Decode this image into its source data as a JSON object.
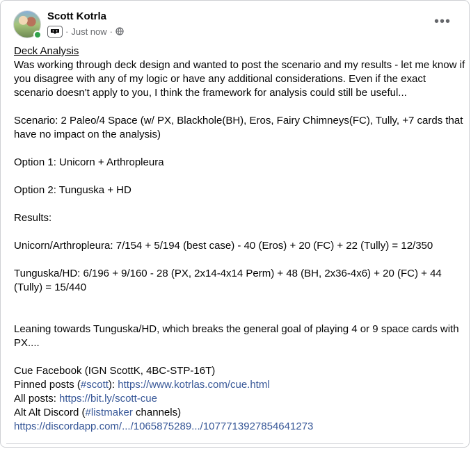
{
  "post": {
    "author": "Scott Kotrla",
    "timestamp": "Just now",
    "separator": "·",
    "title": "Deck Analysis",
    "intro": "Was working through deck design and wanted to post the scenario and my results - let me know if you disagree with any of my logic or have any additional considerations. Even if the exact scenario doesn't apply to you, I think the framework for analysis could still be useful...",
    "scenario": "Scenario: 2 Paleo/4 Space (w/ PX, Blackhole(BH), Eros, Fairy Chimneys(FC), Tully, +7 cards that have no impact on the analysis)",
    "option1": "Option 1: Unicorn + Arthropleura",
    "option2": "Option 2: Tunguska + HD",
    "results_label": "Results:",
    "result1": "Unicorn/Arthropleura: 7/154 + 5/194 (best case) - 40 (Eros) + 20 (FC) + 22 (Tully) = 12/350",
    "result2": "Tunguska/HD: 6/196 + 9/160 - 28 (PX, 2x14-4x14 Perm) + 48 (BH, 2x36-4x6) + 20 (FC) + 44 (Tully) = 15/440",
    "leaning": "Leaning towards Tunguska/HD, which breaks the general goal of playing 4 or 9 space cards with PX....",
    "cue_facebook": "Cue Facebook (IGN ScottK, 4BC-STP-16T)",
    "pinned_prefix": "Pinned posts (",
    "pinned_hashtag": "#scott",
    "pinned_mid": "): ",
    "pinned_link": "https://www.kotrlas.com/cue.html",
    "allposts_prefix": "All posts: ",
    "allposts_link": "https://bit.ly/scott-cue",
    "discord_prefix": "Alt Alt Discord (",
    "discord_hashtag": "#listmaker",
    "discord_suffix": " channels)",
    "discord_link": "https://discordapp.com/.../1065875289.../1077713927854641273"
  },
  "icons": {
    "more": "more-options-icon",
    "audience": "globe-icon",
    "badge": "gaming-badge-icon"
  },
  "colors": {
    "link": "#385898",
    "meta": "#65676b",
    "online": "#31a24c"
  }
}
